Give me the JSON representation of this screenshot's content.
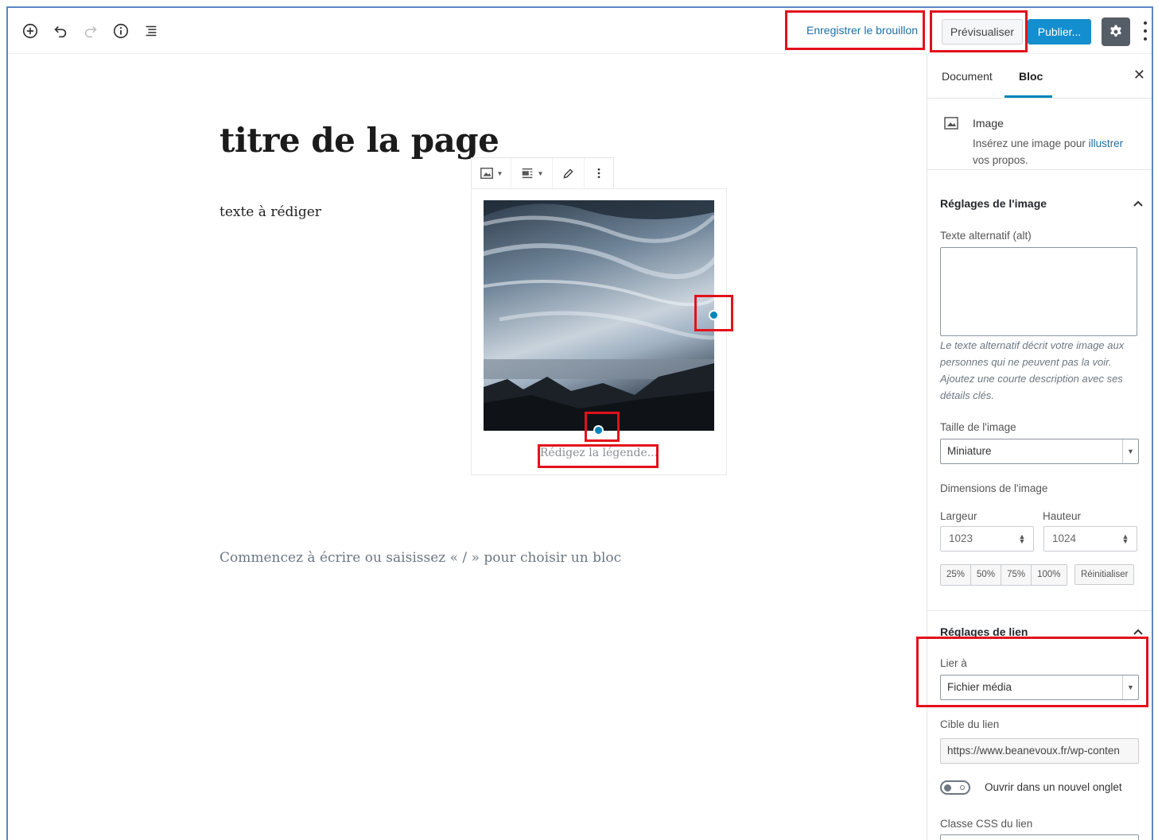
{
  "toolbar": {
    "save_draft": "Enregistrer le brouillon",
    "preview": "Prévisualiser",
    "publish": "Publier...",
    "icons": [
      "add-block-icon",
      "undo-icon",
      "redo-icon",
      "info-icon",
      "outline-icon",
      "gear-icon",
      "more-vertical-icon"
    ]
  },
  "editor": {
    "title": "titre de la page",
    "paragraph": "texte à rédiger",
    "caption_placeholder": "Rédigez la légende...",
    "empty_block_prompt": "Commencez à écrire ou saisissez « / » pour choisir un bloc"
  },
  "sidebar": {
    "tabs": {
      "document": "Document",
      "block": "Bloc"
    },
    "block_card": {
      "name": "Image",
      "desc_before": "Insérez une image pour ",
      "desc_link": "illustrer",
      "desc_after": " vos propos."
    },
    "image_settings": {
      "title": "Réglages de l'image",
      "alt_label": "Texte alternatif (alt)",
      "alt_value": "",
      "alt_help": "Le texte alternatif décrit votre image aux personnes qui ne peuvent pas la voir. Ajoutez une courte description avec ses détails clés.",
      "size_label": "Taille de l'image",
      "size_value": "Miniature",
      "dimensions_label": "Dimensions de l'image",
      "width_label": "Largeur",
      "height_label": "Hauteur",
      "width_value": "1023",
      "height_value": "1024",
      "percent_buttons": [
        "25%",
        "50%",
        "75%",
        "100%"
      ],
      "reset": "Réinitialiser"
    },
    "link_settings": {
      "title": "Réglages de lien",
      "link_to_label": "Lier à",
      "link_to_value": "Fichier média",
      "target_label": "Cible du lien",
      "target_value": "https://www.beanevoux.fr/wp-conten",
      "new_tab_label": "Ouvrir dans un nouvel onglet",
      "css_class_label": "Classe CSS du lien",
      "css_class_value": ""
    }
  },
  "colors": {
    "accent": "#0085ba",
    "publish": "#138ecf",
    "highlight": "#e3111b",
    "settings_button": "#555d66"
  }
}
